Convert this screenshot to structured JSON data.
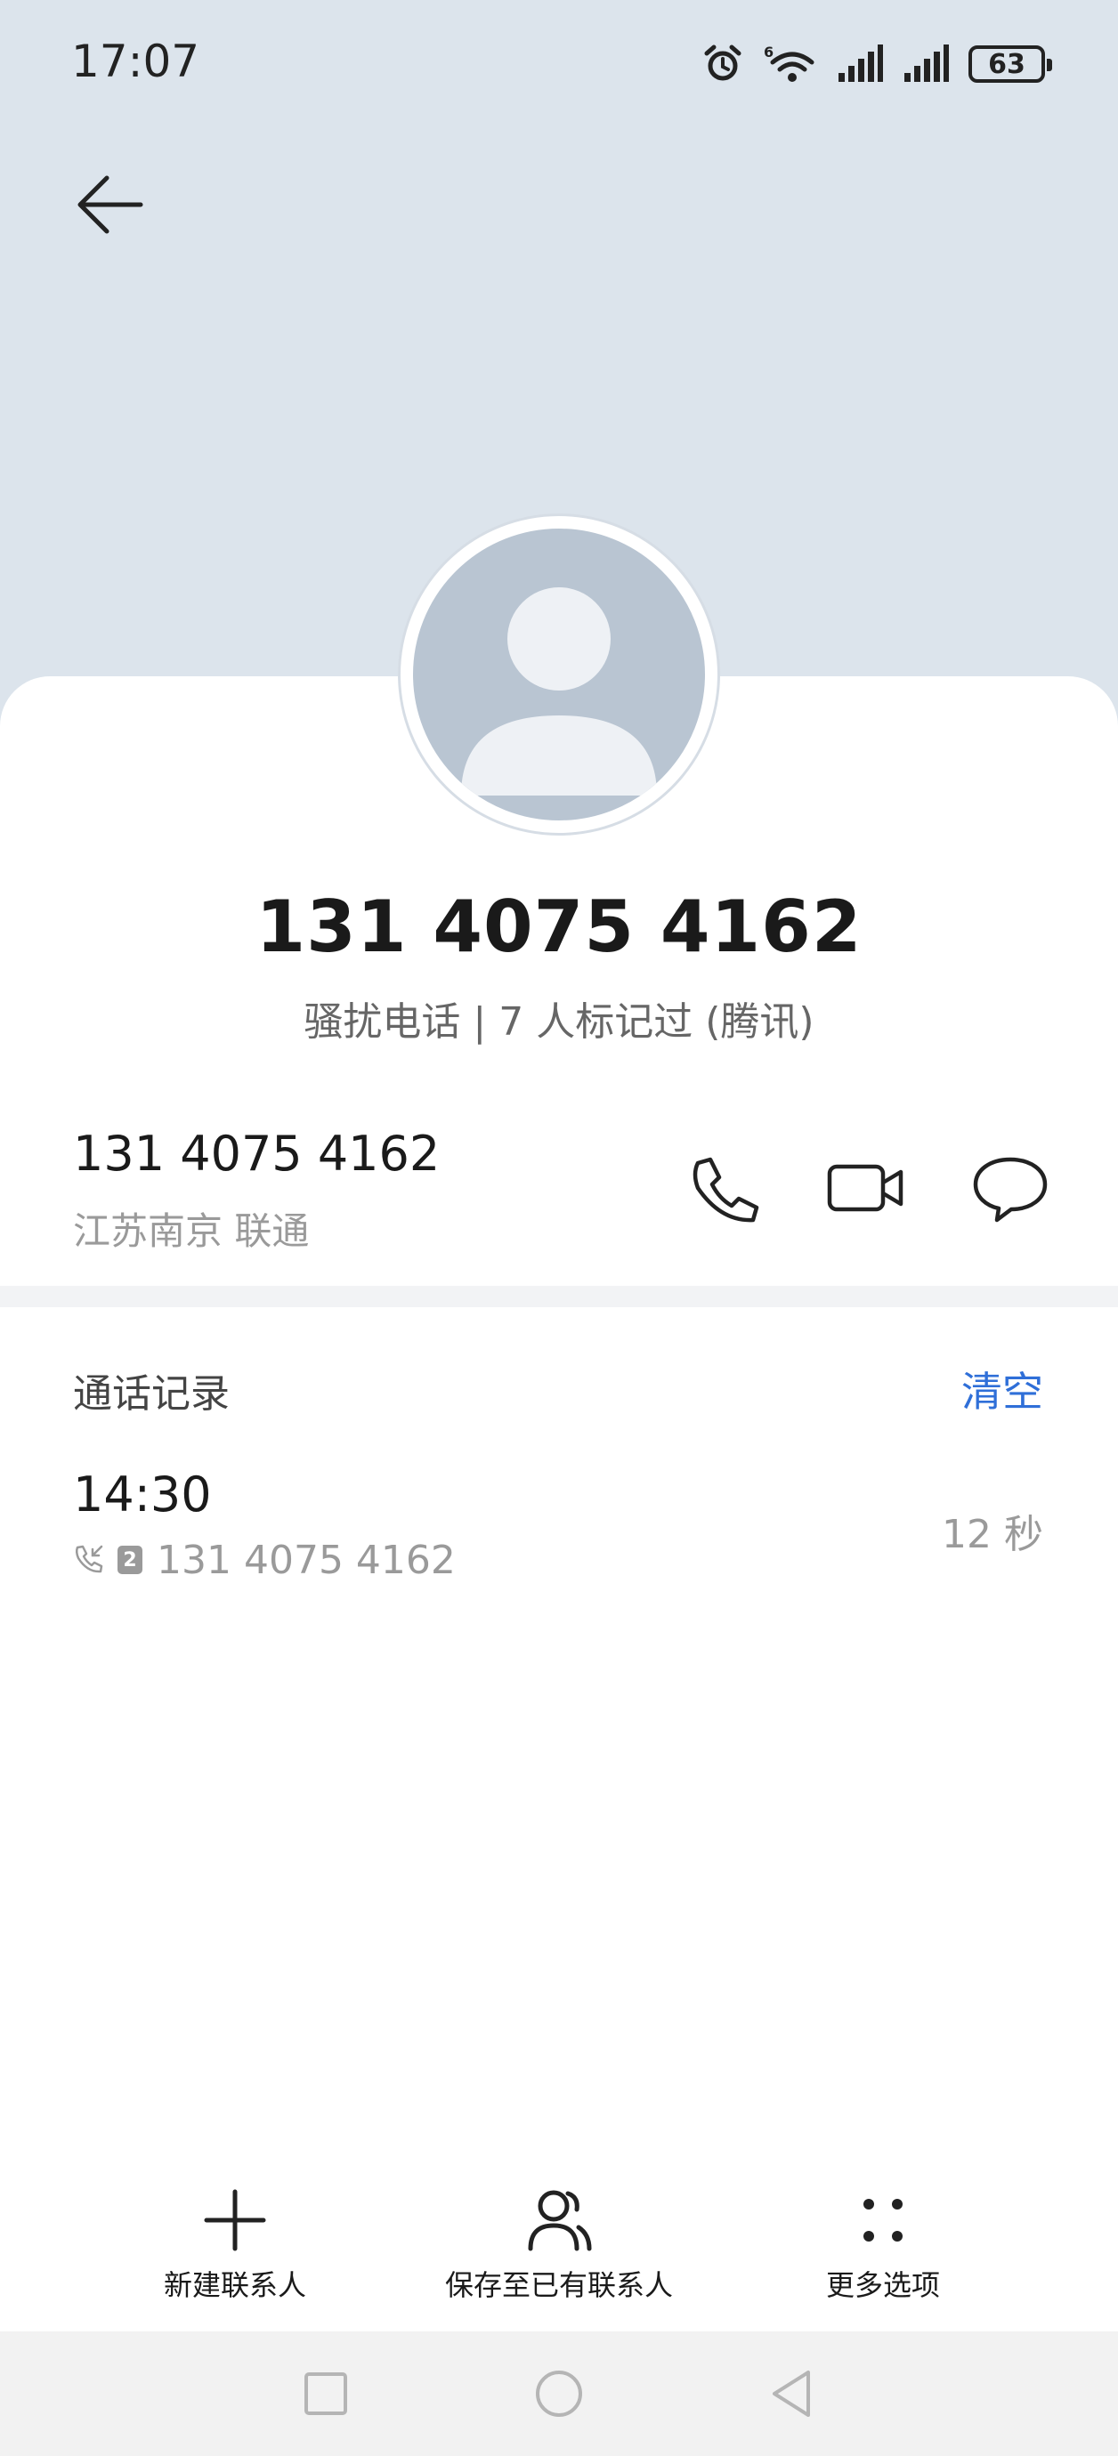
{
  "status_bar": {
    "time": "17:07",
    "network": "6",
    "battery": "63"
  },
  "contact": {
    "display_number": "131 4075 4162",
    "tag": "骚扰电话 | 7 人标记过 (腾讯)",
    "number": "131 4075 4162",
    "location": "江苏南京 联通"
  },
  "actions": {
    "call": "phone-icon",
    "video": "video-call-icon",
    "message": "message-icon"
  },
  "call_log": {
    "title": "通话记录",
    "clear_label": "清空",
    "entries": [
      {
        "time": "14:30",
        "sim": "2",
        "number": "131 4075 4162",
        "duration": "12 秒"
      }
    ]
  },
  "bottom_bar": {
    "new_contact": "新建联系人",
    "save_existing": "保存至已有联系人",
    "more_options": "更多选项"
  },
  "colors": {
    "header_bg": "#dce4ec",
    "accent": "#2f6fd8",
    "avatar": "#b9c5d2"
  }
}
